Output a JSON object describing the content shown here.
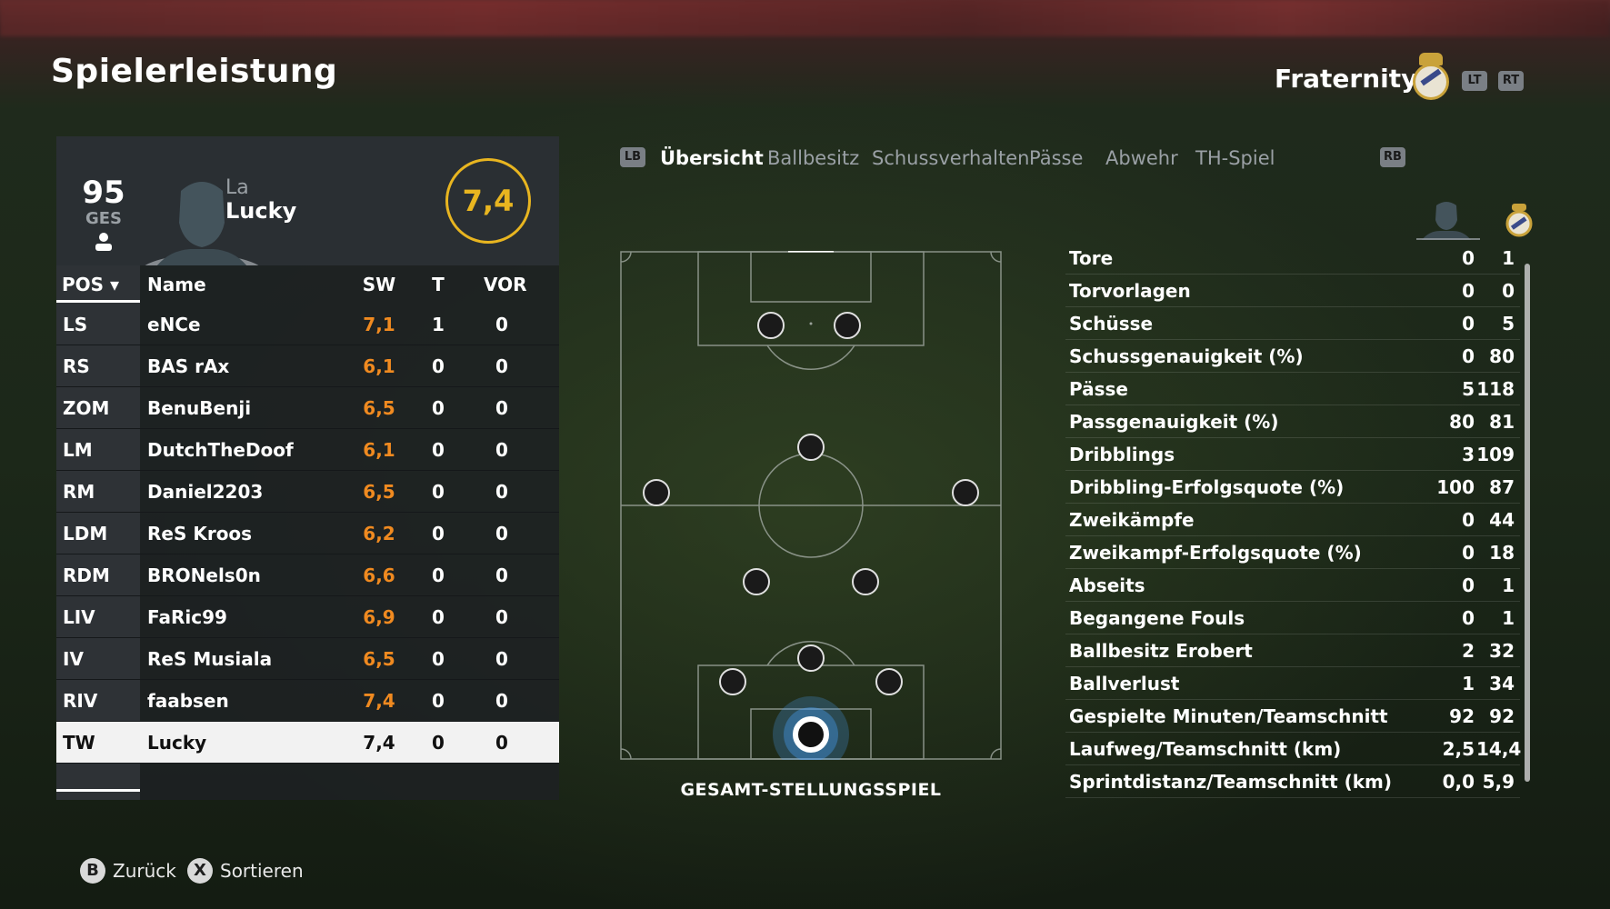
{
  "header": {
    "title": "Spielerleistung",
    "team_name": "Fraternity",
    "lt_label": "LT",
    "rt_label": "RT"
  },
  "player": {
    "overall": "95",
    "overall_label": "GES",
    "first_name": "La",
    "last_name": "Lucky",
    "match_rating": "7,4"
  },
  "table": {
    "headers": {
      "pos": "POS",
      "name": "Name",
      "sw": "SW",
      "t": "T",
      "vor": "VOR"
    },
    "rows": [
      {
        "pos": "LS",
        "name": "eNCe",
        "sw": "7,1",
        "t": "1",
        "vor": "0"
      },
      {
        "pos": "RS",
        "name": "BAS rAx",
        "sw": "6,1",
        "t": "0",
        "vor": "0"
      },
      {
        "pos": "ZOM",
        "name": "BenuBenji",
        "sw": "6,5",
        "t": "0",
        "vor": "0"
      },
      {
        "pos": "LM",
        "name": "DutchTheDoof",
        "sw": "6,1",
        "t": "0",
        "vor": "0"
      },
      {
        "pos": "RM",
        "name": "Daniel2203",
        "sw": "6,5",
        "t": "0",
        "vor": "0"
      },
      {
        "pos": "LDM",
        "name": "ReS Kroos",
        "sw": "6,2",
        "t": "0",
        "vor": "0"
      },
      {
        "pos": "RDM",
        "name": "BRONels0n",
        "sw": "6,6",
        "t": "0",
        "vor": "0"
      },
      {
        "pos": "LIV",
        "name": "FaRic99",
        "sw": "6,9",
        "t": "0",
        "vor": "0"
      },
      {
        "pos": "IV",
        "name": "ReS Musiala",
        "sw": "6,5",
        "t": "0",
        "vor": "0"
      },
      {
        "pos": "RIV",
        "name": "faabsen",
        "sw": "7,4",
        "t": "0",
        "vor": "0"
      },
      {
        "pos": "TW",
        "name": "Lucky",
        "sw": "7,4",
        "t": "0",
        "vor": "0"
      }
    ],
    "selected_row": 10
  },
  "tabs": {
    "lb_label": "LB",
    "rb_label": "RB",
    "items": [
      "Übersicht",
      "Ballbesitz",
      "Schussverhalten",
      "Pässe",
      "Abwehr",
      "TH-Spiel"
    ],
    "active": 0
  },
  "pitch": {
    "label": "GESAMT-STELLUNGSSPIEL"
  },
  "stats": [
    {
      "label": "Tore",
      "player": "0",
      "team": "1"
    },
    {
      "label": "Torvorlagen",
      "player": "0",
      "team": "0"
    },
    {
      "label": "Schüsse",
      "player": "0",
      "team": "5"
    },
    {
      "label": "Schussgenauigkeit (%)",
      "player": "0",
      "team": "80"
    },
    {
      "label": "Pässe",
      "player": "5",
      "team": "118"
    },
    {
      "label": "Passgenauigkeit (%)",
      "player": "80",
      "team": "81"
    },
    {
      "label": "Dribblings",
      "player": "3",
      "team": "109"
    },
    {
      "label": "Dribbling-Erfolgsquote (%)",
      "player": "100",
      "team": "87"
    },
    {
      "label": "Zweikämpfe",
      "player": "0",
      "team": "44"
    },
    {
      "label": "Zweikampf-Erfolgsquote (%)",
      "player": "0",
      "team": "18"
    },
    {
      "label": "Abseits",
      "player": "0",
      "team": "1"
    },
    {
      "label": "Begangene Fouls",
      "player": "0",
      "team": "1"
    },
    {
      "label": "Ballbesitz Erobert",
      "player": "2",
      "team": "32"
    },
    {
      "label": "Ballverlust",
      "player": "1",
      "team": "34"
    },
    {
      "label": "Gespielte Minuten/Teamschnitt",
      "player": "92",
      "team": "92"
    },
    {
      "label": "Laufweg/Teamschnitt (km)",
      "player": "2,5",
      "team": "14,4"
    },
    {
      "label": "Sprintdistanz/Teamschnitt (km)",
      "player": "0,0",
      "team": "5,9"
    }
  ],
  "hints": {
    "back_key": "B",
    "back_label": "Zurück",
    "sort_key": "X",
    "sort_label": "Sortieren"
  },
  "colors": {
    "accent_rating": "#e8b520",
    "sw_value": "#f08a20"
  }
}
